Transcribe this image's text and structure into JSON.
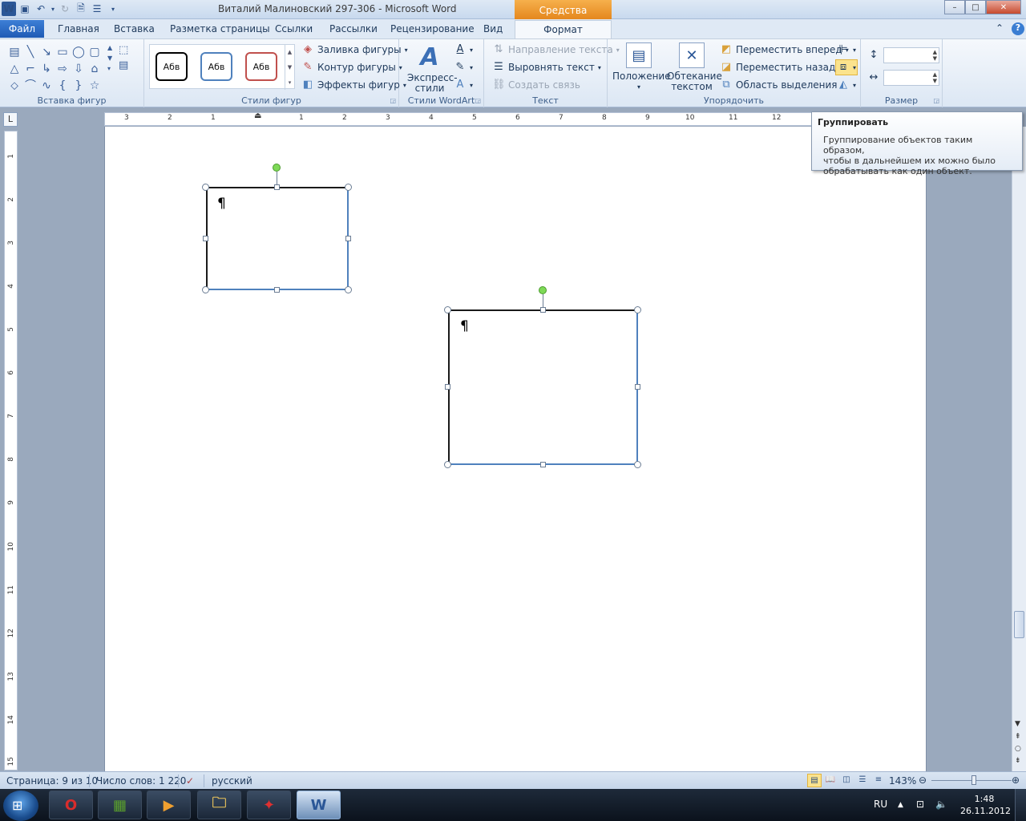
{
  "window": {
    "title": "Виталий Малиновский 297-306  -  Microsoft Word",
    "contextual_tab_header": "Средства рисования",
    "controls": {
      "minimize": "–",
      "maximize": "□",
      "close": "✕"
    }
  },
  "quick_access": {
    "app_icon": "W",
    "undo_icon": "↶",
    "redo_icon": "↻",
    "save_icon": "💾"
  },
  "tabs": [
    "Файл",
    "Главная",
    "Вставка",
    "Разметка страницы",
    "Ссылки",
    "Рассылки",
    "Рецензирование",
    "Вид",
    "Формат"
  ],
  "active_tab": "Формат",
  "ribbon": {
    "insert_shapes": {
      "label": "Вставка фигур"
    },
    "shape_styles": {
      "label": "Стили фигур",
      "samples": [
        "Абв",
        "Абв",
        "Абв"
      ],
      "sample_colors": [
        "#000000",
        "#4f81bd",
        "#c0504d"
      ],
      "fill": "Заливка фигуры",
      "outline": "Контур фигуры",
      "effects": "Эффекты фигур"
    },
    "wordart": {
      "label": "Стили WordArt",
      "quick_styles_line1": "Экспресс-",
      "quick_styles_line2": "стили"
    },
    "text": {
      "label": "Текст",
      "direction": "Направление текста",
      "align": "Выровнять текст",
      "link": "Создать связь"
    },
    "arrange": {
      "label": "Упорядочить",
      "position": "Положение",
      "wrap_line1": "Обтекание",
      "wrap_line2": "текстом",
      "bring_forward": "Переместить вперед",
      "send_backward": "Переместить назад",
      "selection_pane": "Область выделения"
    },
    "size": {
      "label": "Размер",
      "height": "",
      "width": ""
    }
  },
  "tooltip": {
    "title": "Группировать",
    "line1": "Группирование объектов таким образом,",
    "line2": "чтобы в дальнейшем их можно было",
    "line3": "обрабатывать как один объект."
  },
  "ruler": {
    "horizontal": [
      "3",
      "2",
      "1",
      "1",
      "2",
      "3",
      "4",
      "5",
      "6",
      "7",
      "8",
      "9",
      "10",
      "11",
      "12"
    ],
    "vertical": [
      "1",
      "2",
      "3",
      "4",
      "5",
      "6",
      "7",
      "8",
      "9",
      "10",
      "11",
      "12",
      "13",
      "14",
      "15"
    ],
    "corner": "L"
  },
  "document": {
    "pilcrow": "¶"
  },
  "statusbar": {
    "page": "Страница: 9 из 10",
    "words": "Число слов: 1 220",
    "language": "русский",
    "zoom": "143%"
  },
  "taskbar": {
    "language": "RU",
    "time": "1:48",
    "date": "26.11.2012"
  }
}
